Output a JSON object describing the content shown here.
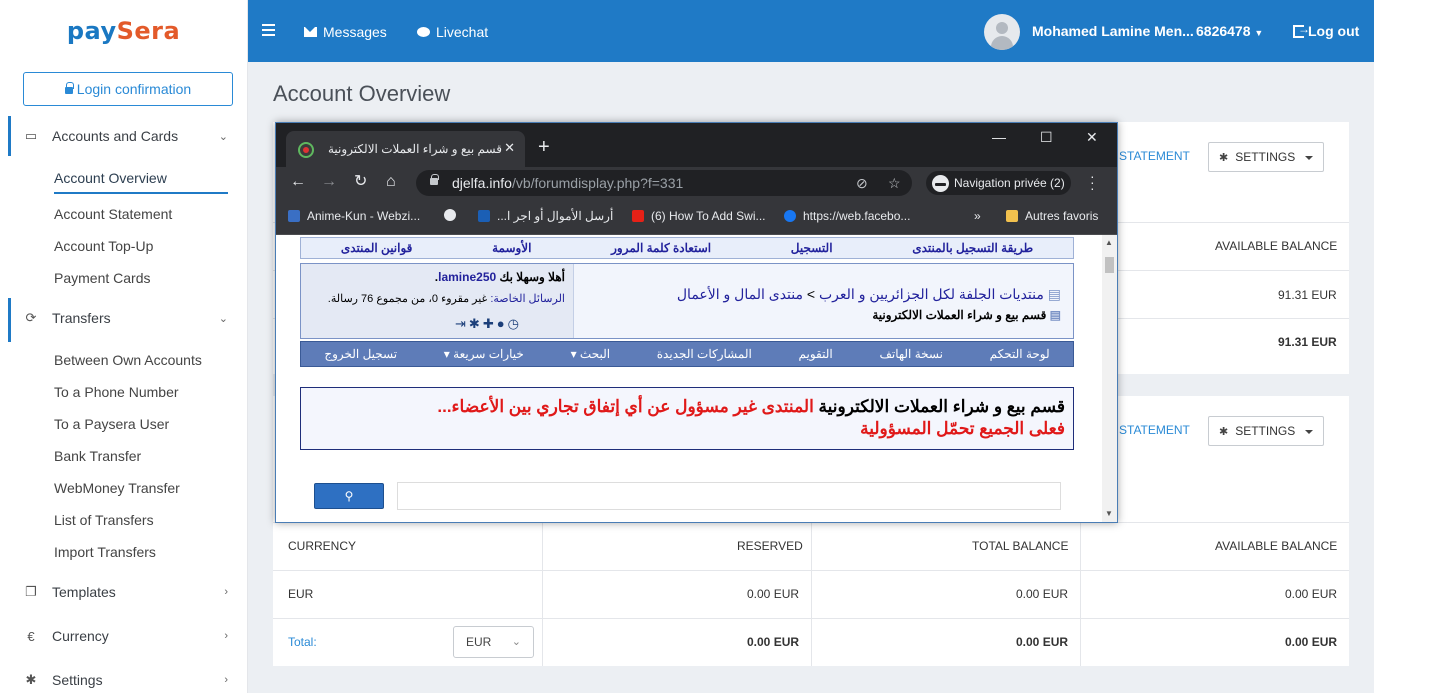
{
  "brand": {
    "name_a": "pay",
    "name_b": "Sera"
  },
  "sidebar": {
    "login_confirmation": "Login confirmation",
    "sections": [
      {
        "label": "Accounts and Cards",
        "items": [
          "Account Overview",
          "Account Statement",
          "Account Top-Up",
          "Payment Cards"
        ]
      },
      {
        "label": "Transfers",
        "items": [
          "Between Own Accounts",
          "To a Phone Number",
          "To a Paysera User",
          "Bank Transfer",
          "WebMoney Transfer",
          "List of Transfers",
          "Import Transfers"
        ]
      },
      {
        "label": "Templates"
      },
      {
        "label": "Currency"
      },
      {
        "label": "Settings"
      }
    ]
  },
  "topbar": {
    "messages": "Messages",
    "livechat": "Livechat",
    "user_name": "Mohamed Lamine Men...",
    "user_id": "6826478",
    "logout": "Log out"
  },
  "main": {
    "title": "Account Overview",
    "card1": {
      "statement_link": "STATEMENT",
      "settings": "SETTINGS",
      "col_available": "AVAILABLE BALANCE",
      "row_value": "91.31 EUR",
      "total_value": "91.31 EUR"
    },
    "card2": {
      "statement_link": "STATEMENT",
      "settings": "SETTINGS",
      "headers": [
        "CURRENCY",
        "RESERVED",
        "TOTAL BALANCE",
        "AVAILABLE BALANCE"
      ],
      "row": [
        "EUR",
        "0.00 EUR",
        "0.00 EUR",
        "0.00 EUR"
      ],
      "total_label": "Total:",
      "total_select": "EUR",
      "totals": [
        "0.00 EUR",
        "0.00 EUR",
        "0.00 EUR"
      ]
    }
  },
  "browser": {
    "tab_title": "قسم بيع و شراء العملات الالكترونية",
    "url_host": "djelfa.info",
    "url_path": "/vb/forumdisplay.php?f=331",
    "incognito": "Navigation privée (2)",
    "bookmarks": [
      "Anime-Kun - Webzi...",
      "أرسل الأموال أو اجر ا...",
      "(6) How To Add Swi...",
      "https://web.facebo...",
      "Autres favoris"
    ],
    "bookmark_more": "»"
  },
  "forum": {
    "top_nav": [
      "طريقة التسجيل بالمنتدى",
      "التسجيل",
      "استعادة كلمة المرور",
      "الأوسمة",
      "قوانين المنتدى"
    ],
    "breadcrumb_root": "منتديات الجلفة لكل الجزائريين و العرب",
    "breadcrumb_sep": ">",
    "breadcrumb_forum": "منتدى المال و الأعمال",
    "current_forum": "قسم بيع و شراء العملات الالكترونية",
    "welcome": "أهلا وسهلا بك",
    "username": "lamine250",
    "pm_label": "الرسائل الخاصة:",
    "pm_text": "غير مقروء 0، من مجموع 76 رسالة.",
    "nav": [
      "لوحة التحكم",
      "نسخة الهاتف",
      "التقويم",
      "المشاركات الجديدة",
      "البحث ▾",
      "خيارات سريعة ▾",
      "تسجيل الخروج"
    ],
    "notice_black": "قسم بيع و شراء العملات الالكترونية",
    "notice_red1": "المنتدى غير مسؤول عن أي إتفاق تجاري بين الأعضاء...",
    "notice_red2": "فعلى الجميع تحمّل المسؤولية"
  },
  "colors": {
    "brand_blue": "#1f7ac6",
    "brand_orange": "#e35a2a",
    "link_blue": "#2a8ad6",
    "forum_red": "#e01919"
  }
}
